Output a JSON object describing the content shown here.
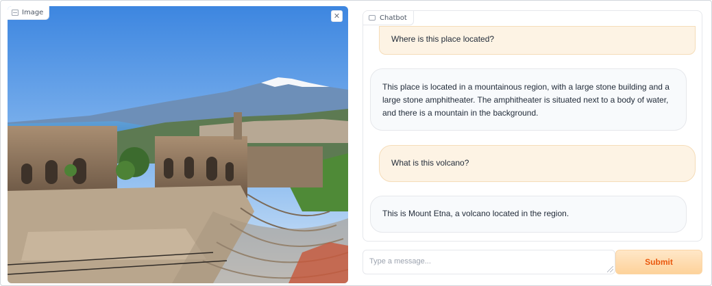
{
  "image_panel": {
    "label": "Image",
    "label_icon": "image-icon",
    "close_icon": "close-icon",
    "close_glyph": "✕"
  },
  "chatbot": {
    "label": "Chatbot",
    "label_icon": "chat-icon",
    "messages": [
      {
        "role": "user",
        "text": "Where is this place located?"
      },
      {
        "role": "bot",
        "text": "This place is located in a mountainous region, with a large stone building and a large stone amphitheater. The amphitheater is situated next to a body of water, and there is a mountain in the background."
      },
      {
        "role": "user",
        "text": "What is this volcano?"
      },
      {
        "role": "bot",
        "text": "This is Mount Etna, a volcano located in the region."
      }
    ]
  },
  "input": {
    "value": "",
    "placeholder": "Type a message..."
  },
  "submit": {
    "label": "Submit"
  },
  "colors": {
    "user_bubble": "#fdf3e4",
    "bot_bubble": "#f8fafc",
    "submit_text": "#ea580c",
    "submit_bg": "#fdd29a"
  }
}
